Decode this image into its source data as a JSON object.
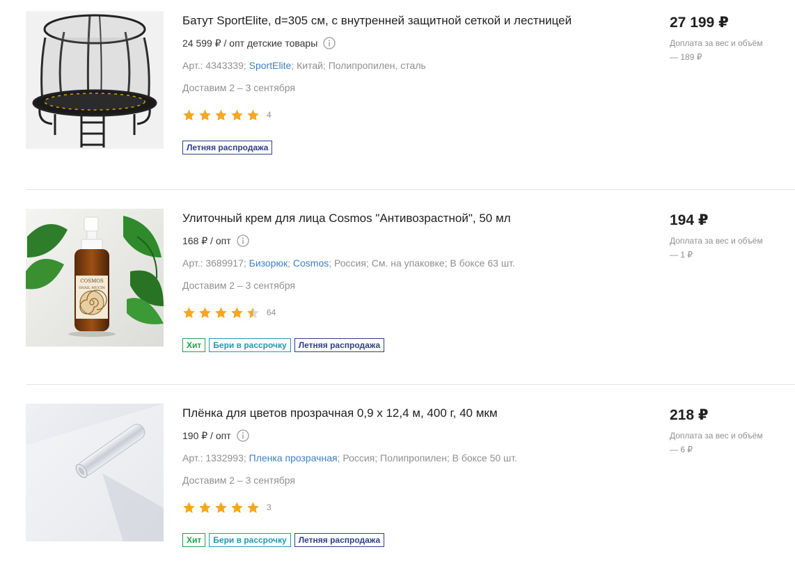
{
  "products": [
    {
      "title": "Батут SportElite, d=305 см, с внутренней защитной сеткой и лестницей",
      "opt": "24 599 ₽ / опт детские товары",
      "art": "Арт.: 4343339;",
      "brand": "SportElite",
      "meta_rest": "; Китай; Полипропилен, сталь",
      "delivery": "Доставим 2 – 3 сентября",
      "rating": 5,
      "reviews": "4",
      "badges": [
        "Летняя распродажа"
      ],
      "price": "27 199 ₽",
      "surcharge": "Доплата за вес и объём — 189 ₽"
    },
    {
      "title": "Улиточный крем для лица Cosmos \"Антивозрастной\", 50 мл",
      "opt": "168 ₽ / опт",
      "art": "Арт.: 3689917;",
      "category": "Бизорюк",
      "brand": "Cosmos",
      "meta_rest": "; Россия; См. на упаковке; В боксе 63 шт.",
      "delivery": "Доставим 2 – 3 сентября",
      "rating": 4.5,
      "reviews": "64",
      "badges": [
        "Хит",
        "Бери в рассрочку",
        "Летняя распродажа"
      ],
      "price": "194 ₽",
      "surcharge": "Доплата за вес и объём — 1 ₽",
      "label_text": [
        "COSMOS",
        "SNAIL MUCIN"
      ]
    },
    {
      "title": "Плёнка для цветов прозрачная 0,9 х 12,4 м, 400 г, 40 мкм",
      "opt": "190 ₽ / опт",
      "art": "Арт.: 1332993;",
      "brand": "Пленка прозрачная",
      "meta_rest": "; Россия; Полипропилен; В боксе 50 шт.",
      "delivery": "Доставим 2 – 3 сентября",
      "rating": 5,
      "reviews": "3",
      "badges": [
        "Хит",
        "Бери в рассрочку",
        "Летняя распродажа"
      ],
      "price": "218 ₽",
      "surcharge": "Доплата за вес и объём — 6 ₽"
    }
  ],
  "colors": {
    "star": "#f5a623",
    "link": "#3d7fc0",
    "badge_sale": "#2f3f87",
    "badge_hit": "#21a04a",
    "badge_credit": "#1c9bb0"
  },
  "icons": {
    "info": "info-circle-icon",
    "star": "star-icon"
  }
}
